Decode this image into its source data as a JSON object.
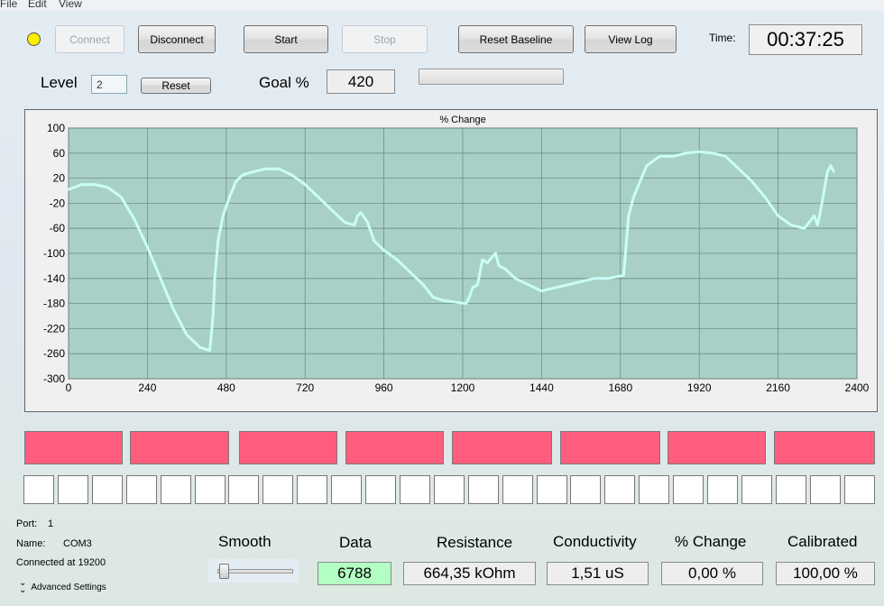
{
  "menu": [
    "File",
    "Edit",
    "View"
  ],
  "toolbar": {
    "connect": "Connect",
    "disconnect": "Disconnect",
    "start": "Start",
    "stop": "Stop",
    "reset_baseline": "Reset Baseline",
    "view_log": "View Log",
    "time_label": "Time:",
    "time_value": "00:37:25"
  },
  "controls": {
    "level_label": "Level",
    "level_value": "2",
    "reset": "Reset",
    "goal_label": "Goal %",
    "goal_value": "420"
  },
  "colors": {
    "status_led": "#ffee00",
    "plot_bg": "#a9d0c6",
    "series_line": "#c9fff6",
    "red_block": "#ff5d7e",
    "data_box": "#b3ffc3"
  },
  "chart_data": {
    "type": "line",
    "title": "% Change",
    "xlabel": "",
    "ylabel": "",
    "xlim": [
      0,
      2400
    ],
    "ylim": [
      -300,
      100
    ],
    "xticks": [
      0,
      240,
      480,
      720,
      960,
      1200,
      1440,
      1680,
      1920,
      2160,
      2400
    ],
    "yticks": [
      100,
      60,
      20,
      -20,
      -60,
      -100,
      -140,
      -180,
      -220,
      -260,
      -300
    ],
    "grid": true,
    "series": [
      {
        "name": "",
        "x": [
          0,
          40,
          80,
          120,
          160,
          200,
          240,
          280,
          320,
          360,
          400,
          430,
          440,
          445,
          455,
          470,
          490,
          510,
          530,
          560,
          600,
          640,
          680,
          720,
          760,
          800,
          840,
          870,
          880,
          890,
          910,
          930,
          960,
          1000,
          1040,
          1080,
          1110,
          1140,
          1180,
          1210,
          1220,
          1230,
          1245,
          1260,
          1275,
          1290,
          1300,
          1310,
          1330,
          1360,
          1400,
          1440,
          1480,
          1520,
          1560,
          1600,
          1640,
          1690,
          1700,
          1705,
          1720,
          1760,
          1800,
          1840,
          1880,
          1920,
          1960,
          2000,
          2040,
          2080,
          2120,
          2160,
          2200,
          2240,
          2270,
          2280,
          2290,
          2300,
          2310,
          2320,
          2330
        ],
        "y": [
          2,
          10,
          10,
          5,
          -10,
          -45,
          -90,
          -140,
          -190,
          -230,
          -250,
          -255,
          -200,
          -140,
          -80,
          -40,
          -10,
          15,
          25,
          30,
          35,
          35,
          25,
          10,
          -10,
          -30,
          -50,
          -55,
          -40,
          -35,
          -50,
          -80,
          -95,
          -110,
          -130,
          -150,
          -170,
          -175,
          -178,
          -180,
          -170,
          -155,
          -150,
          -110,
          -115,
          -105,
          -100,
          -120,
          -125,
          -140,
          -150,
          -160,
          -155,
          -150,
          -145,
          -140,
          -140,
          -135,
          -70,
          -40,
          -10,
          40,
          55,
          55,
          60,
          62,
          60,
          55,
          35,
          15,
          -10,
          -40,
          -55,
          -60,
          -40,
          -55,
          -30,
          0,
          30,
          40,
          30
        ]
      }
    ]
  },
  "status_blocks": {
    "red_count": 8,
    "white_count": 25
  },
  "connection": {
    "port_label": "Port:",
    "port_value": "1",
    "name_label": "Name:",
    "name_value": "COM3",
    "connected_text": "Connected at 19200",
    "advanced_settings": "Advanced Settings"
  },
  "readouts": {
    "smooth_label": "Smooth",
    "smooth_level": 0.05,
    "data_label": "Data",
    "data_value": "6788",
    "resistance_label": "Resistance",
    "resistance_value": "664,35 kOhm",
    "conductivity_label": "Conductivity",
    "conductivity_value": "1,51 uS",
    "pct_change_label": "% Change",
    "pct_change_value": "0,00 %",
    "calibrated_label": "Calibrated",
    "calibrated_value": "100,00 %"
  }
}
